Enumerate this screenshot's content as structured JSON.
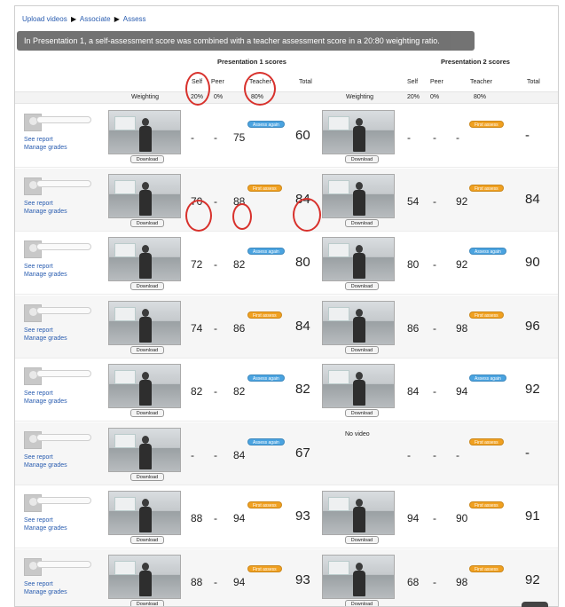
{
  "breadcrumb": [
    "Upload videos",
    "Associate",
    "Assess"
  ],
  "tooltip": "In Presentation 1, a self-assessment score was combined with a teacher assessment score in a 20:80 weighting ratio.",
  "p1": {
    "title": "Presentation 1 scores",
    "self": "Self",
    "peer": "Peer",
    "teacher": "Teacher",
    "total": "Total",
    "weighting_label": "Weighting",
    "self_w": "20%",
    "peer_w": "0%",
    "teacher_w": "80%"
  },
  "p2": {
    "title": "Presentation 2 scores",
    "self": "Self",
    "peer": "Peer",
    "teacher": "Teacher",
    "total": "Total",
    "weighting_label": "Weighting",
    "self_w": "20%",
    "peer_w": "0%",
    "teacher_w": "80%"
  },
  "labels": {
    "see_report": "See report",
    "manage_grades": "Manage grades",
    "download": "Download",
    "no_video": "No video",
    "assess_again": "Assess again",
    "first_assess": "First assess"
  },
  "colors": {
    "link": "#2a5db0",
    "highlight": "#d8312c",
    "assess_again": "#4aa3e0",
    "first_assess": "#f0a020"
  },
  "students": [
    {
      "p1": {
        "self": "-",
        "peer": "-",
        "teacher": "75",
        "badge": "Assess again",
        "total": "60",
        "video": true
      },
      "p2": {
        "self": "-",
        "peer": "-",
        "teacher": "-",
        "badge": "First assess",
        "total": "-",
        "video": true
      }
    },
    {
      "p1": {
        "self": "70",
        "peer": "-",
        "teacher": "88",
        "badge": "First assess",
        "total": "84",
        "video": true
      },
      "p2": {
        "self": "54",
        "peer": "-",
        "teacher": "92",
        "badge": "First assess",
        "total": "84",
        "video": true
      }
    },
    {
      "p1": {
        "self": "72",
        "peer": "-",
        "teacher": "82",
        "badge": "Assess again",
        "total": "80",
        "video": true
      },
      "p2": {
        "self": "80",
        "peer": "-",
        "teacher": "92",
        "badge": "Assess again",
        "total": "90",
        "video": true
      }
    },
    {
      "p1": {
        "self": "74",
        "peer": "-",
        "teacher": "86",
        "badge": "First assess",
        "total": "84",
        "video": true
      },
      "p2": {
        "self": "86",
        "peer": "-",
        "teacher": "98",
        "badge": "First assess",
        "total": "96",
        "video": true
      }
    },
    {
      "p1": {
        "self": "82",
        "peer": "-",
        "teacher": "82",
        "badge": "Assess again",
        "total": "82",
        "video": true
      },
      "p2": {
        "self": "84",
        "peer": "-",
        "teacher": "94",
        "badge": "Assess again",
        "total": "92",
        "video": true
      }
    },
    {
      "p1": {
        "self": "-",
        "peer": "-",
        "teacher": "84",
        "badge": "Assess again",
        "total": "67",
        "video": true
      },
      "p2": {
        "self": "-",
        "peer": "-",
        "teacher": "-",
        "badge": "First assess",
        "total": "-",
        "video": false
      }
    },
    {
      "p1": {
        "self": "88",
        "peer": "-",
        "teacher": "94",
        "badge": "First assess",
        "total": "93",
        "video": true
      },
      "p2": {
        "self": "94",
        "peer": "-",
        "teacher": "90",
        "badge": "First assess",
        "total": "91",
        "video": true
      }
    },
    {
      "p1": {
        "self": "88",
        "peer": "-",
        "teacher": "94",
        "badge": "First assess",
        "total": "93",
        "video": true
      },
      "p2": {
        "self": "68",
        "peer": "-",
        "teacher": "98",
        "badge": "First assess",
        "total": "92",
        "video": true
      }
    }
  ]
}
